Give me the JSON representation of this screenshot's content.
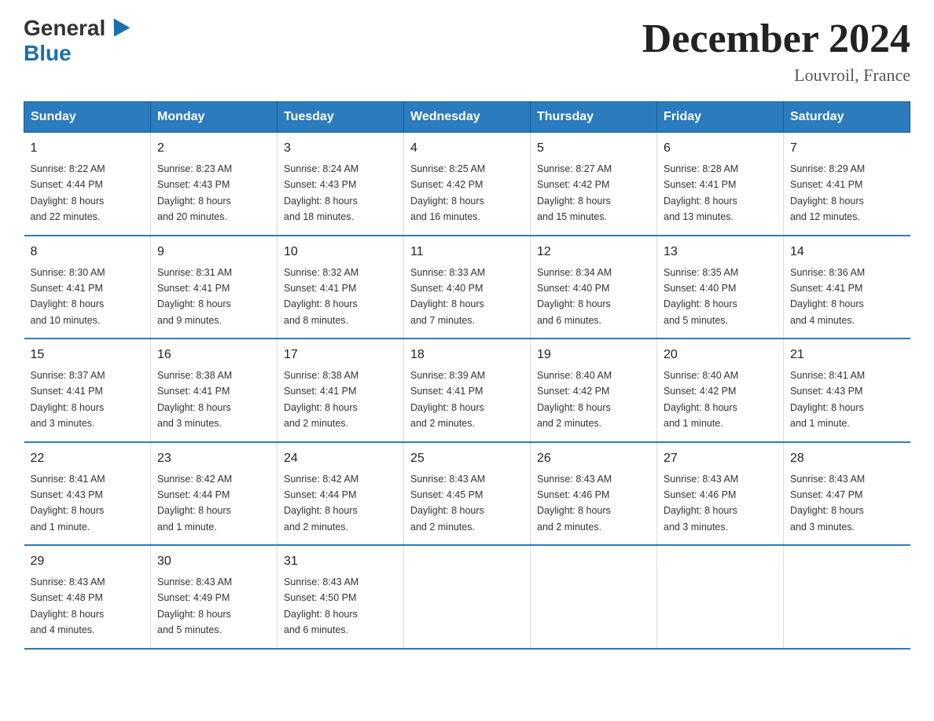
{
  "header": {
    "logo_general": "General",
    "logo_blue": "Blue",
    "month_title": "December 2024",
    "location": "Louvroil, France"
  },
  "days_of_week": [
    "Sunday",
    "Monday",
    "Tuesday",
    "Wednesday",
    "Thursday",
    "Friday",
    "Saturday"
  ],
  "weeks": [
    [
      {
        "day": "1",
        "info": "Sunrise: 8:22 AM\nSunset: 4:44 PM\nDaylight: 8 hours\nand 22 minutes."
      },
      {
        "day": "2",
        "info": "Sunrise: 8:23 AM\nSunset: 4:43 PM\nDaylight: 8 hours\nand 20 minutes."
      },
      {
        "day": "3",
        "info": "Sunrise: 8:24 AM\nSunset: 4:43 PM\nDaylight: 8 hours\nand 18 minutes."
      },
      {
        "day": "4",
        "info": "Sunrise: 8:25 AM\nSunset: 4:42 PM\nDaylight: 8 hours\nand 16 minutes."
      },
      {
        "day": "5",
        "info": "Sunrise: 8:27 AM\nSunset: 4:42 PM\nDaylight: 8 hours\nand 15 minutes."
      },
      {
        "day": "6",
        "info": "Sunrise: 8:28 AM\nSunset: 4:41 PM\nDaylight: 8 hours\nand 13 minutes."
      },
      {
        "day": "7",
        "info": "Sunrise: 8:29 AM\nSunset: 4:41 PM\nDaylight: 8 hours\nand 12 minutes."
      }
    ],
    [
      {
        "day": "8",
        "info": "Sunrise: 8:30 AM\nSunset: 4:41 PM\nDaylight: 8 hours\nand 10 minutes."
      },
      {
        "day": "9",
        "info": "Sunrise: 8:31 AM\nSunset: 4:41 PM\nDaylight: 8 hours\nand 9 minutes."
      },
      {
        "day": "10",
        "info": "Sunrise: 8:32 AM\nSunset: 4:41 PM\nDaylight: 8 hours\nand 8 minutes."
      },
      {
        "day": "11",
        "info": "Sunrise: 8:33 AM\nSunset: 4:40 PM\nDaylight: 8 hours\nand 7 minutes."
      },
      {
        "day": "12",
        "info": "Sunrise: 8:34 AM\nSunset: 4:40 PM\nDaylight: 8 hours\nand 6 minutes."
      },
      {
        "day": "13",
        "info": "Sunrise: 8:35 AM\nSunset: 4:40 PM\nDaylight: 8 hours\nand 5 minutes."
      },
      {
        "day": "14",
        "info": "Sunrise: 8:36 AM\nSunset: 4:41 PM\nDaylight: 8 hours\nand 4 minutes."
      }
    ],
    [
      {
        "day": "15",
        "info": "Sunrise: 8:37 AM\nSunset: 4:41 PM\nDaylight: 8 hours\nand 3 minutes."
      },
      {
        "day": "16",
        "info": "Sunrise: 8:38 AM\nSunset: 4:41 PM\nDaylight: 8 hours\nand 3 minutes."
      },
      {
        "day": "17",
        "info": "Sunrise: 8:38 AM\nSunset: 4:41 PM\nDaylight: 8 hours\nand 2 minutes."
      },
      {
        "day": "18",
        "info": "Sunrise: 8:39 AM\nSunset: 4:41 PM\nDaylight: 8 hours\nand 2 minutes."
      },
      {
        "day": "19",
        "info": "Sunrise: 8:40 AM\nSunset: 4:42 PM\nDaylight: 8 hours\nand 2 minutes."
      },
      {
        "day": "20",
        "info": "Sunrise: 8:40 AM\nSunset: 4:42 PM\nDaylight: 8 hours\nand 1 minute."
      },
      {
        "day": "21",
        "info": "Sunrise: 8:41 AM\nSunset: 4:43 PM\nDaylight: 8 hours\nand 1 minute."
      }
    ],
    [
      {
        "day": "22",
        "info": "Sunrise: 8:41 AM\nSunset: 4:43 PM\nDaylight: 8 hours\nand 1 minute."
      },
      {
        "day": "23",
        "info": "Sunrise: 8:42 AM\nSunset: 4:44 PM\nDaylight: 8 hours\nand 1 minute."
      },
      {
        "day": "24",
        "info": "Sunrise: 8:42 AM\nSunset: 4:44 PM\nDaylight: 8 hours\nand 2 minutes."
      },
      {
        "day": "25",
        "info": "Sunrise: 8:43 AM\nSunset: 4:45 PM\nDaylight: 8 hours\nand 2 minutes."
      },
      {
        "day": "26",
        "info": "Sunrise: 8:43 AM\nSunset: 4:46 PM\nDaylight: 8 hours\nand 2 minutes."
      },
      {
        "day": "27",
        "info": "Sunrise: 8:43 AM\nSunset: 4:46 PM\nDaylight: 8 hours\nand 3 minutes."
      },
      {
        "day": "28",
        "info": "Sunrise: 8:43 AM\nSunset: 4:47 PM\nDaylight: 8 hours\nand 3 minutes."
      }
    ],
    [
      {
        "day": "29",
        "info": "Sunrise: 8:43 AM\nSunset: 4:48 PM\nDaylight: 8 hours\nand 4 minutes."
      },
      {
        "day": "30",
        "info": "Sunrise: 8:43 AM\nSunset: 4:49 PM\nDaylight: 8 hours\nand 5 minutes."
      },
      {
        "day": "31",
        "info": "Sunrise: 8:43 AM\nSunset: 4:50 PM\nDaylight: 8 hours\nand 6 minutes."
      },
      null,
      null,
      null,
      null
    ]
  ]
}
